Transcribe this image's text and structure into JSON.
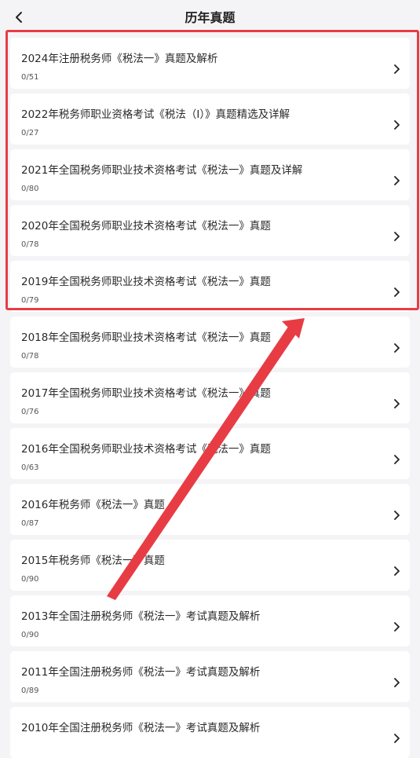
{
  "header": {
    "title": "历年真题",
    "back_icon": "chevron-left-icon"
  },
  "colors": {
    "annotation": "#e83c44",
    "background": "#f4f4f6",
    "card": "#ffffff"
  },
  "items": [
    {
      "title": "2024年注册税务师《税法一》真题及解析",
      "progress": "0/51"
    },
    {
      "title": "2022年税务师职业资格考试《税法（I）》真题精选及详解",
      "progress": "0/27"
    },
    {
      "title": "2021年全国税务师职业技术资格考试《税法一》真题及详解",
      "progress": "0/80"
    },
    {
      "title": "2020年全国税务师职业技术资格考试《税法一》真题",
      "progress": "0/78"
    },
    {
      "title": "2019年全国税务师职业技术资格考试《税法一》真题",
      "progress": "0/79"
    },
    {
      "title": "2018年全国税务师职业技术资格考试《税法一》真题",
      "progress": "0/78"
    },
    {
      "title": "2017年全国税务师职业技术资格考试《税法一》真题",
      "progress": "0/76"
    },
    {
      "title": "2016年全国税务师职业技术资格考试《税法一》真题",
      "progress": "0/63"
    },
    {
      "title": "2016年税务师《税法一》真题",
      "progress": "0/87"
    },
    {
      "title": "2015年税务师《税法一》真题",
      "progress": "0/90"
    },
    {
      "title": "2013年全国注册税务师《税法一》考试真题及解析",
      "progress": "0/90"
    },
    {
      "title": "2011年全国注册税务师《税法一》考试真题及解析",
      "progress": "0/89"
    },
    {
      "title": "2010年全国注册税务师《税法一》考试真题及解析",
      "progress": ""
    }
  ]
}
